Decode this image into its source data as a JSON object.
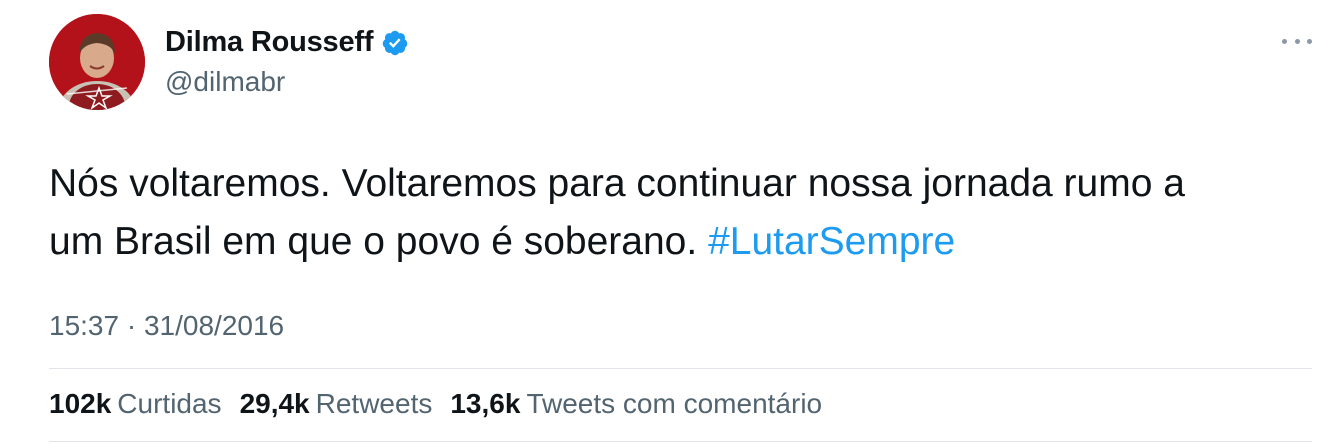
{
  "tweet": {
    "author": {
      "display_name": "Dilma Rousseff",
      "handle": "@dilmabr",
      "verified": true,
      "verified_icon": "verified-badge-icon",
      "verified_color": "#1d9bf0"
    },
    "text_line1": "Nós voltaremos. Voltaremos para continuar nossa jornada rumo a",
    "text_line2": "um Brasil em que o povo é soberano.",
    "hashtag": "#LutarSempre",
    "hashtag_color": "#1d9bf0",
    "time": "15:37",
    "separator": "·",
    "date": "31/08/2016",
    "stats": {
      "likes_count": "102k",
      "likes_label": "Curtidas",
      "retweets_count": "29,4k",
      "retweets_label": "Retweets",
      "quotes_count": "13,6k",
      "quotes_label": "Tweets com comentário"
    },
    "more_icon": "more-horizontal-icon"
  }
}
